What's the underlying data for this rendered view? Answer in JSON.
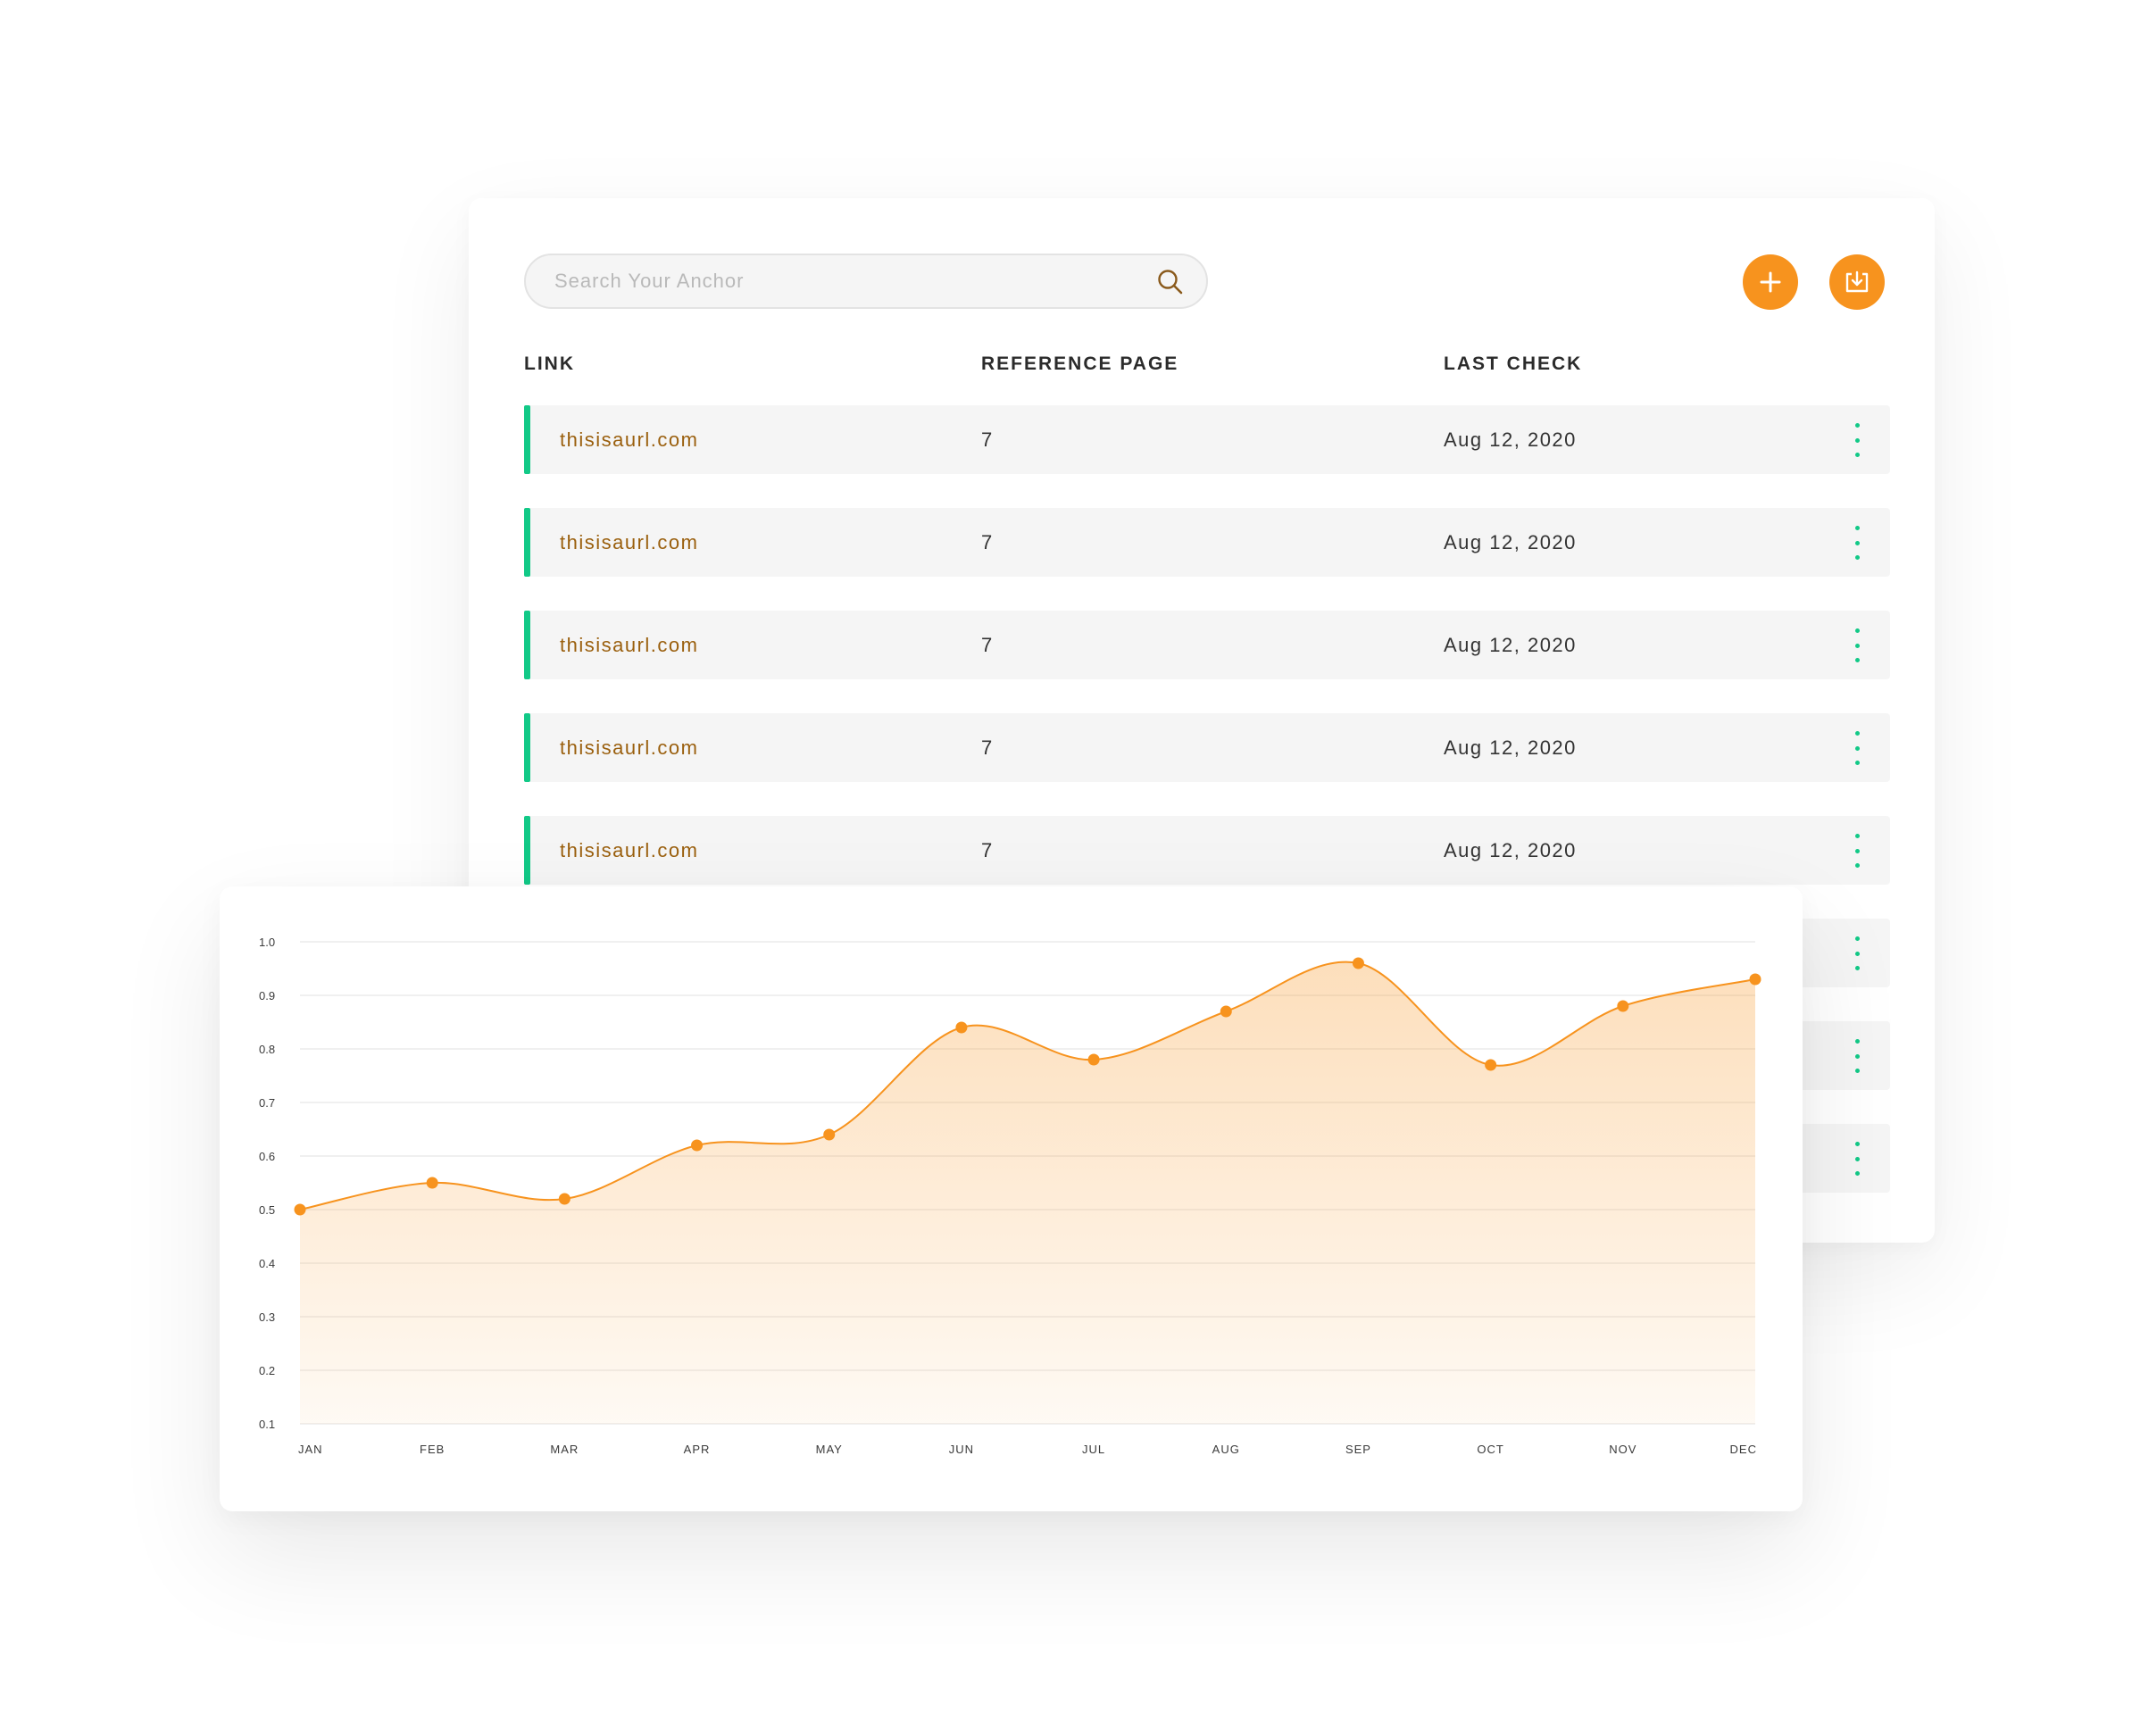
{
  "search": {
    "placeholder": "Search Your Anchor"
  },
  "actions": {
    "add_icon": "plus-icon",
    "download_icon": "download-icon",
    "accent_color": "#f7931e"
  },
  "table": {
    "headers": [
      "LINK",
      "REFERENCE PAGE",
      "LAST CHECK"
    ],
    "status_color": "#12c987",
    "rows": [
      {
        "link": "thisisaurl.com",
        "reference_page": "7",
        "last_check": "Aug 12, 2020"
      },
      {
        "link": "thisisaurl.com",
        "reference_page": "7",
        "last_check": "Aug 12, 2020"
      },
      {
        "link": "thisisaurl.com",
        "reference_page": "7",
        "last_check": "Aug 12, 2020"
      },
      {
        "link": "thisisaurl.com",
        "reference_page": "7",
        "last_check": "Aug 12, 2020"
      },
      {
        "link": "thisisaurl.com",
        "reference_page": "7",
        "last_check": "Aug 12, 2020"
      },
      {
        "link": "",
        "reference_page": "",
        "last_check": ""
      },
      {
        "link": "",
        "reference_page": "",
        "last_check": ""
      },
      {
        "link": "",
        "reference_page": "",
        "last_check": ""
      }
    ]
  },
  "chart_data": {
    "type": "area",
    "categories": [
      "JAN",
      "FEB",
      "MAR",
      "APR",
      "MAY",
      "JUN",
      "JUL",
      "AUG",
      "SEP",
      "OCT",
      "NOV",
      "DEC"
    ],
    "values": [
      0.5,
      0.55,
      0.52,
      0.62,
      0.64,
      0.84,
      0.78,
      0.87,
      0.96,
      0.77,
      0.88,
      0.93
    ],
    "y_ticks": [
      "0.1",
      "0.2",
      "0.3",
      "0.4",
      "0.5",
      "0.6",
      "0.7",
      "0.8",
      "0.9",
      "1.0"
    ],
    "ylim": [
      0.1,
      1.0
    ],
    "grid": true,
    "smooth": true,
    "color": "#f7931e"
  }
}
